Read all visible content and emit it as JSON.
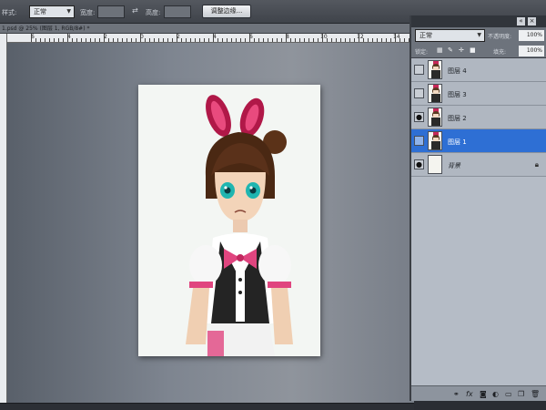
{
  "options_bar": {
    "style_label": "样式:",
    "style_value": "正常",
    "width_label": "宽度:",
    "height_label": "高度:",
    "refine_edge_button": "调整边缘..."
  },
  "document_tab": {
    "title": "1.psd @ 25% (图层 1, RGB/8#) *"
  },
  "ruler": {
    "labels": [
      "6",
      "4",
      "2",
      "0",
      "2",
      "4",
      "6",
      "8",
      "10",
      "12",
      "14"
    ]
  },
  "layers_panel": {
    "blend_mode": "正常",
    "opacity_label": "不透明度:",
    "opacity_value": "100%",
    "lock_label": "锁定:",
    "fill_label": "填充:",
    "fill_value": "100%",
    "layers": [
      {
        "name": "图层 4",
        "visible": false,
        "selected": false
      },
      {
        "name": "图层 3",
        "visible": false,
        "selected": false
      },
      {
        "name": "图层 2",
        "visible": true,
        "selected": false
      },
      {
        "name": "图层 1",
        "visible": false,
        "selected": true
      },
      {
        "name": "背景",
        "visible": true,
        "selected": false,
        "locked": true
      }
    ]
  },
  "icons": {
    "link": "link-icon",
    "fx": "fx-icon",
    "mask": "mask-icon",
    "adjustment": "adjustment-icon",
    "group": "folder-icon",
    "new_layer": "new-layer-icon",
    "delete": "trash-icon"
  },
  "colors": {
    "selection": "#2e6fd4",
    "panel": "#b5bcc6"
  }
}
